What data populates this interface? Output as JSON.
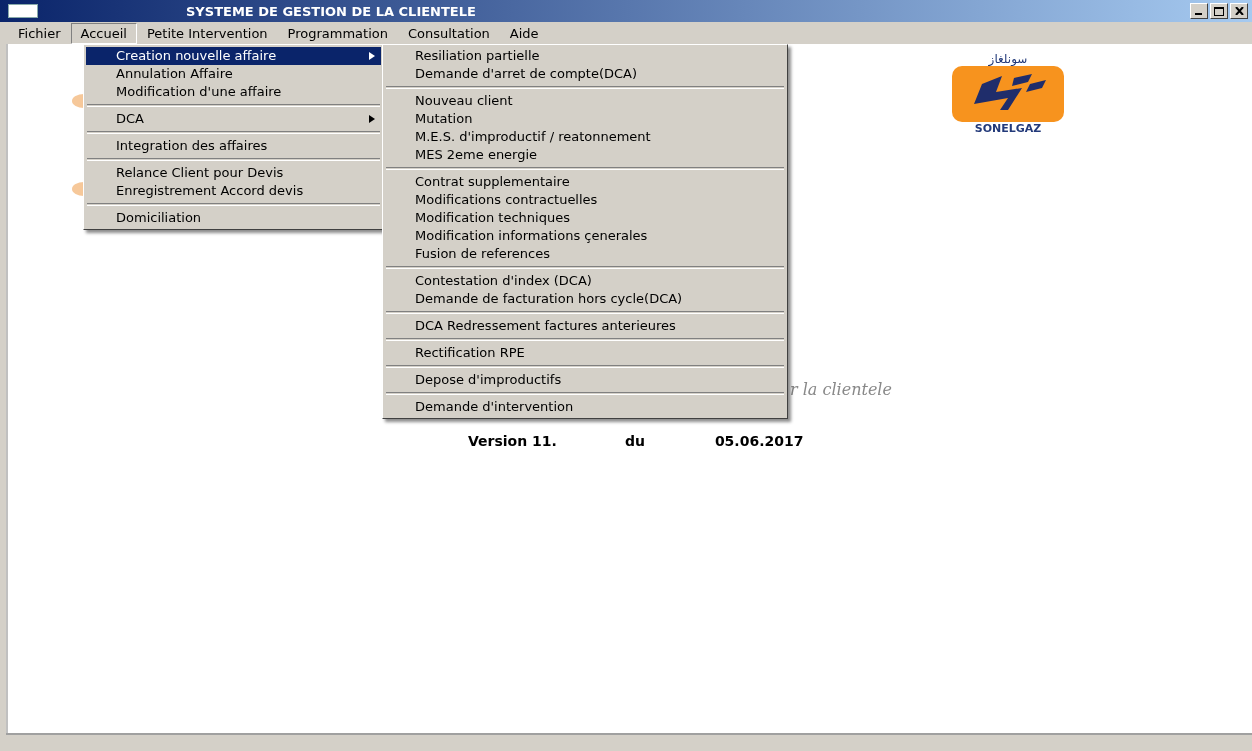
{
  "window": {
    "title": "SYSTEME DE GESTION DE LA CLIENTELE"
  },
  "menu_bar": [
    {
      "label": "Fichier",
      "selected": false
    },
    {
      "label": "Accueil",
      "selected": true
    },
    {
      "label": "Petite Intervention",
      "selected": false
    },
    {
      "label": "Programmation",
      "selected": false
    },
    {
      "label": "Consultation",
      "selected": false
    },
    {
      "label": "Aide",
      "selected": false
    }
  ],
  "accueil_menu": [
    [
      {
        "label": "Creation nouvelle affaire",
        "selected": true,
        "submenu": true
      },
      {
        "label": "Annulation Affaire",
        "selected": false,
        "submenu": false
      },
      {
        "label": "Modification d'une affaire",
        "selected": false,
        "submenu": false
      }
    ],
    [
      {
        "label": "DCA",
        "selected": false,
        "submenu": true
      }
    ],
    [
      {
        "label": "Integration des affaires",
        "selected": false,
        "submenu": false
      }
    ],
    [
      {
        "label": "Relance Client pour Devis",
        "selected": false,
        "submenu": false
      },
      {
        "label": "Enregistrement Accord devis",
        "selected": false,
        "submenu": false
      }
    ],
    [
      {
        "label": "Domiciliation",
        "selected": false,
        "submenu": false
      }
    ]
  ],
  "submenu": [
    [
      "Resiliation partielle",
      "Demande d'arret de compte(DCA)"
    ],
    [
      "Nouveau client",
      "Mutation",
      "M.E.S. d'improductif / reatonnement",
      "MES 2eme energie"
    ],
    [
      "Contrat supplementaire",
      "Modifications contractuelles",
      "Modification techniques",
      "Modification informations çenerales",
      "Fusion de references"
    ],
    [
      "Contestation d'index (DCA)",
      "Demande de facturation hors cycle(DCA)"
    ],
    [
      "DCA Redressement factures anterieures"
    ],
    [
      "Rectification RPE"
    ],
    [
      "Depose d'improductifs"
    ],
    [
      "Demande d'intervention"
    ]
  ],
  "logo": {
    "arabic": "سونلغاز",
    "caption": "SONELGAZ"
  },
  "tagline": "r la clientele",
  "version": {
    "label": "Version 11.",
    "du": "du",
    "date": "05.06.2017"
  }
}
